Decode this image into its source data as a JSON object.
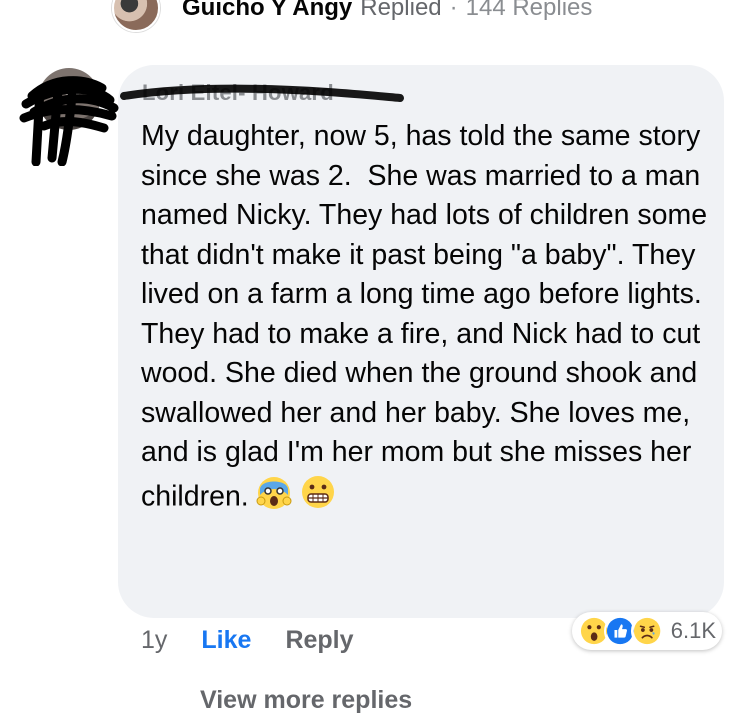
{
  "reply_summary": {
    "name": "Guicho Y Angy",
    "replied": "Replied",
    "separator": "·",
    "count": "144 Replies"
  },
  "comment": {
    "author": "Lori Eitel- Howard",
    "text": "My daughter, now 5, has told the same story since she was 2.  She was married to a man named Nicky. They had lots of children some that didn't make it past being \"a baby\". They lived on a farm a long time ago before lights. They had to make a fire, and Nick had to cut wood. She died when the ground shook and swallowed her and her baby. She loves me, and is glad I'm her mom but she misses her children."
  },
  "emojis": [
    "face-screaming-icon",
    "grimacing-face-icon"
  ],
  "actions": {
    "age": "1y",
    "like": "Like",
    "reply": "Reply"
  },
  "reactions": {
    "icons": [
      "wow-reaction-icon",
      "like-reaction-icon",
      "sad-reaction-icon"
    ],
    "count": "6.1K"
  },
  "more_replies": "View more replies",
  "colors": {
    "bubble": "#f0f2f5",
    "like_blue": "#1877f2",
    "secondary_text": "#65676b"
  }
}
